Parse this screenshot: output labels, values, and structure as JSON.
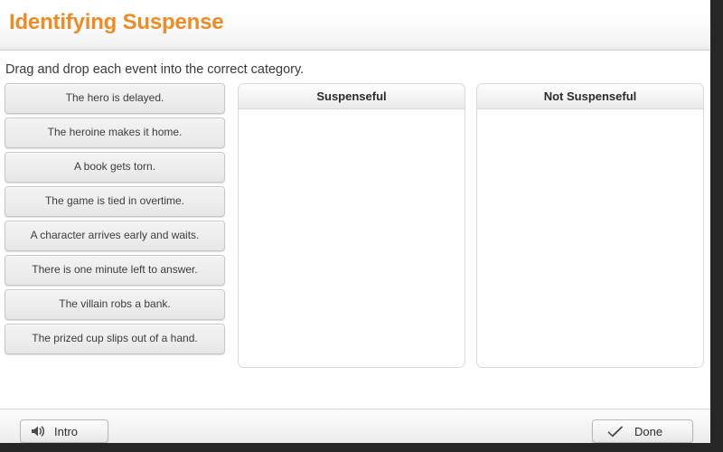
{
  "header": {
    "title": "Identifying Suspense"
  },
  "instruction": "Drag and drop each event into the correct category.",
  "drag_items": [
    {
      "label": "The hero is delayed."
    },
    {
      "label": "The heroine makes it home."
    },
    {
      "label": "A book gets torn."
    },
    {
      "label": "The game is tied in overtime."
    },
    {
      "label": "A character arrives early and waits."
    },
    {
      "label": "There is one minute left to answer."
    },
    {
      "label": "The villain robs a bank."
    },
    {
      "label": "The prized cup slips out of a hand."
    }
  ],
  "dropzones": [
    {
      "title": "Suspenseful",
      "items": []
    },
    {
      "title": "Not Suspenseful",
      "items": []
    }
  ],
  "toolbar": {
    "intro_label": "Intro",
    "intro_icon": "speaker-icon",
    "done_label": "Done",
    "done_icon": "checkmark-icon"
  },
  "colors": {
    "title_orange": "#ef8b22",
    "text_dark": "#3a3a3a",
    "panel_border": "#d8d8d8",
    "chrome_dark": "#262626"
  }
}
